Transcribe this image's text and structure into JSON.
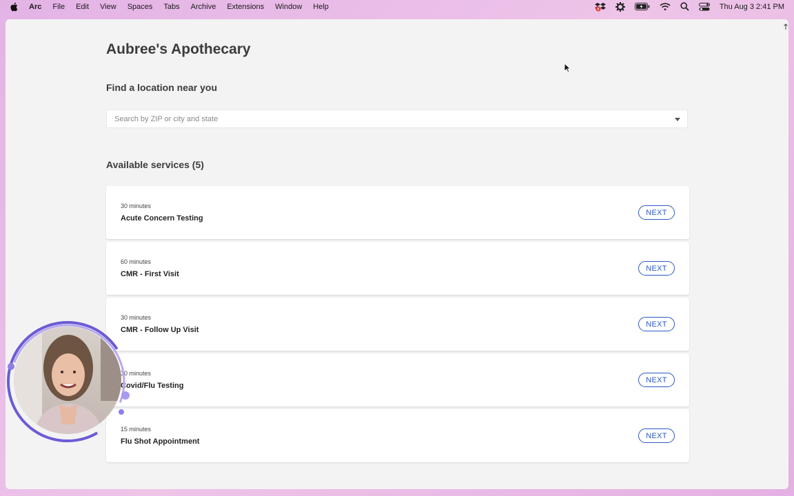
{
  "menubar": {
    "app_name": "Arc",
    "menus": [
      "File",
      "Edit",
      "View",
      "Spaces",
      "Tabs",
      "Archive",
      "Extensions",
      "Window",
      "Help"
    ],
    "clock": "Thu Aug 3  2:41 PM",
    "status_icons": [
      "dropbox-icon",
      "settings-gear-icon",
      "battery-icon",
      "wifi-icon",
      "spotlight-search-icon",
      "control-center-icon"
    ]
  },
  "page": {
    "title": "Aubree's Apothecary",
    "find_heading": "Find a location near you",
    "search_placeholder": "Search by ZIP or city and state",
    "services_heading": "Available services (5)"
  },
  "services": [
    {
      "duration": "30 minutes",
      "name": "Acute Concern Testing",
      "action": "NEXT"
    },
    {
      "duration": "60 minutes",
      "name": "CMR - First Visit",
      "action": "NEXT"
    },
    {
      "duration": "30 minutes",
      "name": "CMR - Follow Up Visit",
      "action": "NEXT"
    },
    {
      "duration": "30 minutes",
      "name": "Covid/Flu Testing",
      "action": "NEXT"
    },
    {
      "duration": "15 minutes",
      "name": "Flu Shot Appointment",
      "action": "NEXT"
    }
  ],
  "colors": {
    "accent": "#2b57c4",
    "desktop": "#e3b3e6",
    "webcam_ring": "#6b5bd6"
  }
}
